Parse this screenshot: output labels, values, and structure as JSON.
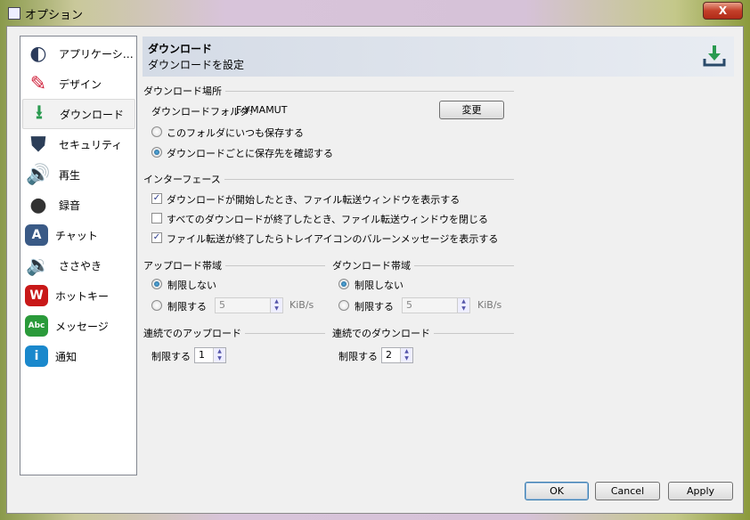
{
  "window": {
    "title": "オプション",
    "close_label": "X"
  },
  "sidebar": {
    "items": [
      {
        "label": "アプリケーシ…",
        "icon": "app-logo-icon",
        "color": "#2a3a5a"
      },
      {
        "label": "デザイン",
        "icon": "design-pencil-icon",
        "color": "#d0203a"
      },
      {
        "label": "ダウンロード",
        "icon": "download-icon",
        "color": "#2a9a50"
      },
      {
        "label": "セキュリティ",
        "icon": "shield-icon",
        "color": "#2c3e58"
      },
      {
        "label": "再生",
        "icon": "speaker-icon",
        "color": "#444"
      },
      {
        "label": "録音",
        "icon": "microphone-icon",
        "color": "#333"
      },
      {
        "label": "チャット",
        "icon": "chat-bubble-icon",
        "color": "#3a5a86"
      },
      {
        "label": "ささやき",
        "icon": "whisper-speaker-icon",
        "color": "#444"
      },
      {
        "label": "ホットキー",
        "icon": "hotkey-icon",
        "color": "#c81818"
      },
      {
        "label": "メッセージ",
        "icon": "message-icon",
        "color": "#2a9a3a"
      },
      {
        "label": "通知",
        "icon": "info-icon",
        "color": "#1a88cc"
      }
    ],
    "selected": 2
  },
  "header": {
    "title": "ダウンロード",
    "subtitle": "ダウンロードを設定"
  },
  "location": {
    "group": "ダウンロード場所",
    "folder_label": "ダウンロードフォルダ:",
    "folder_value": "F:¥MAMUT",
    "change_button": "変更",
    "options": [
      {
        "label": "このフォルダにいつも保存する",
        "checked": false
      },
      {
        "label": "ダウンロードごとに保存先を確認する",
        "checked": true
      }
    ]
  },
  "interface": {
    "group": "インターフェース",
    "options": [
      {
        "label": "ダウンロードが開始したとき、ファイル転送ウィンドウを表示する",
        "checked": true
      },
      {
        "label": "すべてのダウンロードが終了したとき、ファイル転送ウィンドウを閉じる",
        "checked": false
      },
      {
        "label": "ファイル転送が終了したらトレイアイコンのバルーンメッセージを表示する",
        "checked": true
      }
    ]
  },
  "upload_bw": {
    "group": "アップロード帯域",
    "no_limit": "制限しない",
    "limit": "制限する",
    "value": "5",
    "unit": "KiB/s",
    "selected": "no_limit"
  },
  "download_bw": {
    "group": "ダウンロード帯域",
    "no_limit": "制限しない",
    "limit": "制限する",
    "value": "5",
    "unit": "KiB/s",
    "selected": "no_limit"
  },
  "concurrent_up": {
    "group": "連続でのアップロード",
    "label": "制限する",
    "value": "1"
  },
  "concurrent_down": {
    "group": "連続でのダウンロード",
    "label": "制限する",
    "value": "2"
  },
  "footer": {
    "ok": "OK",
    "cancel": "Cancel",
    "apply": "Apply"
  }
}
